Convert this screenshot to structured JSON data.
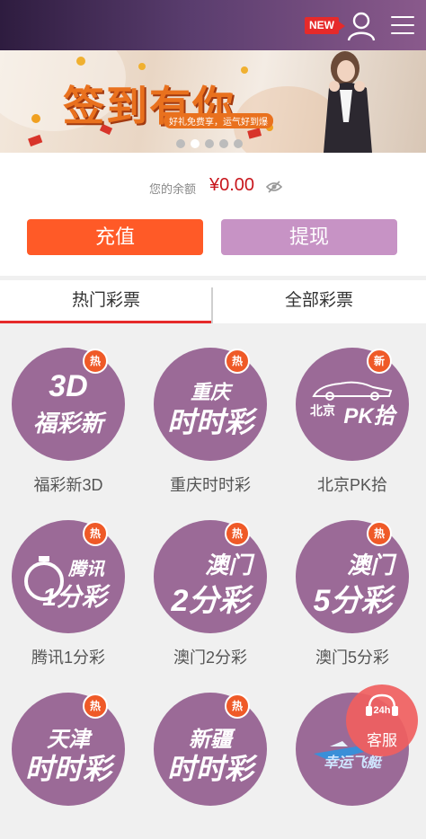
{
  "header": {
    "new_badge": "NEW",
    "user_icon": "user-icon",
    "menu_icon": "menu-icon"
  },
  "banner": {
    "title": "签到有你",
    "subtitle": "好礼免费享，运气好到爆",
    "slides_total": 5,
    "active_slide": 2
  },
  "wallet": {
    "balance_label": "您的余额",
    "balance_value": "¥0.00",
    "recharge_label": "充值",
    "withdraw_label": "提现",
    "colors": {
      "recharge": "#ff5a27",
      "withdraw": "#c793c5",
      "balance": "#c8161d"
    }
  },
  "tabs": [
    {
      "label": "热门彩票",
      "active": true
    },
    {
      "label": "全部彩票",
      "active": false
    }
  ],
  "lotteries": [
    {
      "name": "福彩新3D",
      "logo_line1": "3D",
      "logo_line2": "福彩新",
      "badge": "热"
    },
    {
      "name": "重庆时时彩",
      "logo_line1": "重庆",
      "logo_line2": "时时彩",
      "badge": "热"
    },
    {
      "name": "北京PK拾",
      "logo_line1": "北京",
      "logo_line2": "PK拾",
      "badge": "新"
    },
    {
      "name": "腾讯1分彩",
      "logo_line1": "腾讯",
      "logo_line2": "1分彩",
      "badge": "热"
    },
    {
      "name": "澳门2分彩",
      "logo_line1": "澳门",
      "logo_line2": "2分彩",
      "badge": "热"
    },
    {
      "name": "澳门5分彩",
      "logo_line1": "澳门",
      "logo_line2": "5分彩",
      "badge": "热"
    },
    {
      "name": "",
      "logo_line1": "天津",
      "logo_line2": "时时彩",
      "badge": "热"
    },
    {
      "name": "",
      "logo_line1": "新疆",
      "logo_line2": "时时彩",
      "badge": "热"
    },
    {
      "name": "",
      "logo_line1": "",
      "logo_line2": "幸运飞艇",
      "badge": ""
    }
  ],
  "customer_service": {
    "label": "客服",
    "hours": "24h"
  }
}
